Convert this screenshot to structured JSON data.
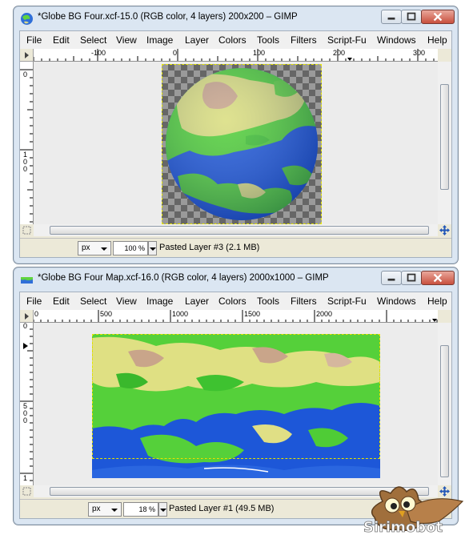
{
  "windows": [
    {
      "title": "*Globe BG Four.xcf-15.0 (RGB color, 4 layers) 200x200 – GIMP",
      "menu": [
        "File",
        "Edit",
        "Select",
        "View",
        "Image",
        "Layer",
        "Colors",
        "Tools",
        "Filters",
        "Script-Fu",
        "Windows",
        "Help"
      ],
      "hruler_labels": [
        "-100",
        "0",
        "100",
        "200",
        "300"
      ],
      "vruler_labels": [
        "0",
        "1\n0\n0"
      ],
      "status": {
        "unit": "px",
        "zoom": "100 %",
        "layer": "Pasted Layer #3 (2.1 MB)"
      }
    },
    {
      "title": "*Globe BG Four Map.xcf-16.0 (RGB color, 4 layers) 2000x1000 – GIMP",
      "menu": [
        "File",
        "Edit",
        "Select",
        "View",
        "Image",
        "Layer",
        "Colors",
        "Tools",
        "Filters",
        "Script-Fu",
        "Windows",
        "Help"
      ],
      "hruler_labels": [
        "0",
        "500",
        "1000",
        "1500",
        "2000"
      ],
      "vruler_labels": [
        "0",
        "5\n0\n0",
        "1"
      ],
      "status": {
        "unit": "px",
        "zoom": "18 %",
        "layer": "Pasted Layer #1 (49.5 MB)"
      }
    }
  ],
  "watermark": {
    "text": "Sirimobot"
  },
  "colors": {
    "ocean": "#1a55d6",
    "land_green": "#57d53a",
    "land_yellow": "#e8e08c",
    "land_pink": "#c9a890",
    "window_frame": "#dbe6f2"
  }
}
